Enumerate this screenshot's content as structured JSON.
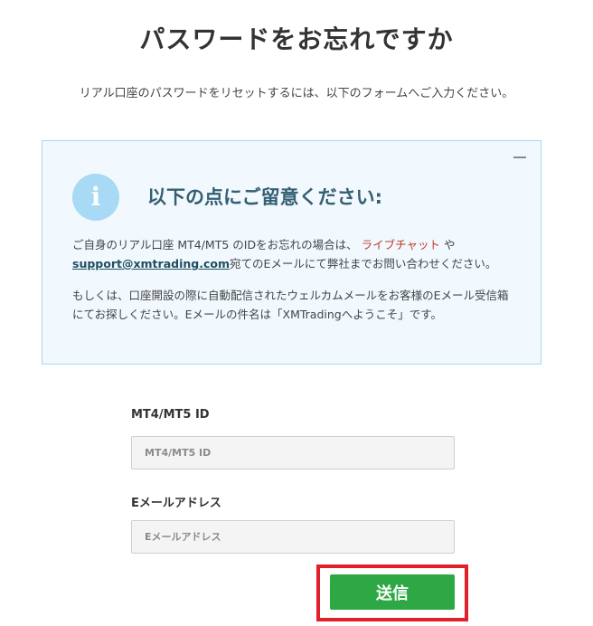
{
  "page": {
    "title": "パスワードをお忘れですか",
    "subtitle": "リアル口座のパスワードをリセットするには、以下のフォームへご入力ください。"
  },
  "notice": {
    "heading": "以下の点にご留意ください:",
    "icon_glyph": "i",
    "para1_before": "ご自身のリアル口座 MT4/MT5 のIDをお忘れの場合は、",
    "para1_live_chat": "ライブチャット",
    "para1_mid": "や",
    "para1_email": "support@xmtrading.com",
    "para1_after": "宛てのEメールにて弊社までお問い合わせください。",
    "para2": "もしくは、口座開設の際に自動配信されたウェルカムメールをお客様のEメール受信箱にてお探しください。Eメールの件名は「XMTradingへようこそ」です。"
  },
  "form": {
    "id_label": "MT4/MT5 ID",
    "id_placeholder": "MT4/MT5 ID",
    "email_label": "Eメールアドレス",
    "email_placeholder": "Eメールアドレス",
    "submit_label": "送信"
  },
  "colors": {
    "submit_bg": "#2ea845",
    "highlight_border": "#e0202a",
    "notice_bg": "#f1f9fe",
    "link_live_chat": "#c0392b"
  }
}
